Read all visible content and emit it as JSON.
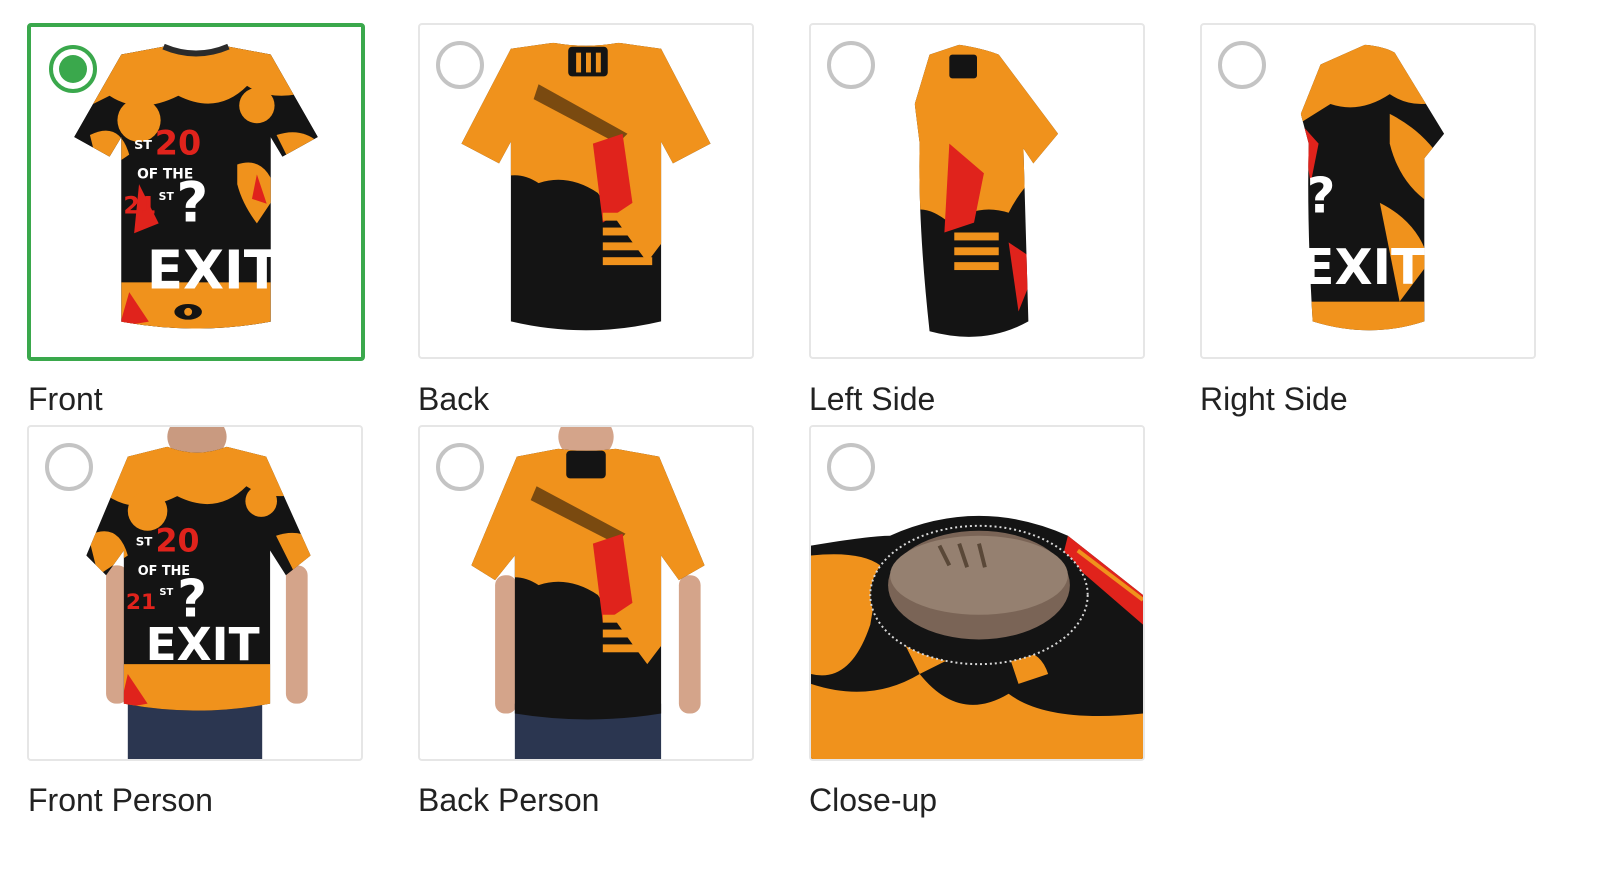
{
  "views": [
    {
      "id": "front",
      "label": "Front",
      "selected": true
    },
    {
      "id": "back",
      "label": "Back",
      "selected": false
    },
    {
      "id": "left-side",
      "label": "Left Side",
      "selected": false
    },
    {
      "id": "right-side",
      "label": "Right Side",
      "selected": false
    },
    {
      "id": "front-person",
      "label": "Front Person",
      "selected": false
    },
    {
      "id": "back-person",
      "label": "Back Person",
      "selected": false
    },
    {
      "id": "close-up",
      "label": "Close-up",
      "selected": false
    }
  ],
  "shirt_print": {
    "line1": "ST",
    "number": "20",
    "line2": "OF THE",
    "line3": "21",
    "line4": "ST",
    "symbol": "?",
    "word": "EXIT"
  },
  "colors": {
    "selected_accent": "#3aa84c",
    "radio_unselected": "#c4c4c4",
    "shirt_orange": "#f0921c",
    "shirt_black": "#141414",
    "shirt_red": "#e0231c"
  }
}
